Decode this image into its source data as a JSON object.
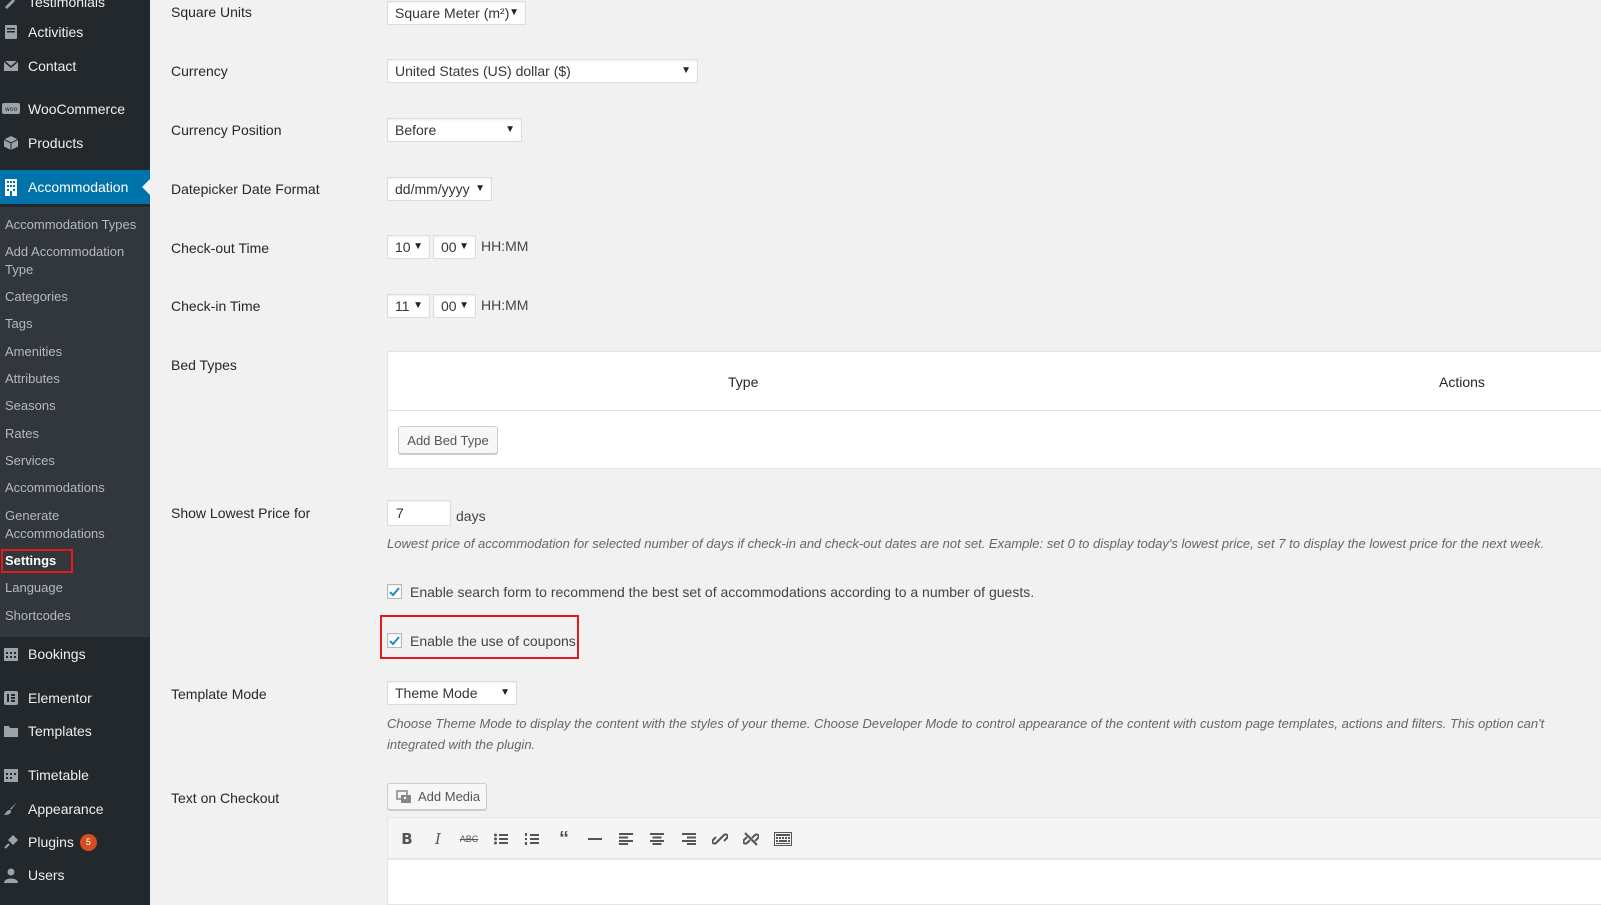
{
  "sidebar": {
    "menu": [
      {
        "label": "Testimonials",
        "icon": "testimonials-icon"
      },
      {
        "label": "Activities",
        "icon": "activities-icon"
      },
      {
        "label": "Contact",
        "icon": "mail-icon"
      },
      {
        "label": "WooCommerce",
        "icon": "woocommerce-icon"
      },
      {
        "label": "Products",
        "icon": "box-icon"
      },
      {
        "label": "Accommodation",
        "icon": "building-icon"
      },
      {
        "label": "Bookings",
        "icon": "calendar-icon"
      },
      {
        "label": "Elementor",
        "icon": "elementor-icon"
      },
      {
        "label": "Templates",
        "icon": "folder-icon"
      },
      {
        "label": "Timetable",
        "icon": "calendar-icon"
      },
      {
        "label": "Appearance",
        "icon": "paintbrush-icon"
      },
      {
        "label": "Plugins",
        "icon": "plug-icon",
        "badge": "5"
      },
      {
        "label": "Users",
        "icon": "users-icon"
      }
    ],
    "submenu": [
      "Accommodation Types",
      "Add Accommodation Type",
      "Categories",
      "Tags",
      "Amenities",
      "Attributes",
      "Seasons",
      "Rates",
      "Services",
      "Accommodations",
      "Generate Accommodations",
      "Settings",
      "Language",
      "Shortcodes"
    ]
  },
  "form": {
    "square_units": {
      "label": "Square Units",
      "value": "Square Meter (m²)"
    },
    "currency": {
      "label": "Currency",
      "value": "United States (US) dollar ($)"
    },
    "currency_position": {
      "label": "Currency Position",
      "value": "Before"
    },
    "date_format": {
      "label": "Datepicker Date Format",
      "value": "dd/mm/yyyy"
    },
    "checkout_time": {
      "label": "Check-out Time",
      "hour": "10",
      "minute": "00",
      "hint": "HH:MM"
    },
    "checkin_time": {
      "label": "Check-in Time",
      "hour": "11",
      "minute": "00",
      "hint": "HH:MM"
    },
    "bed_types": {
      "label": "Bed Types",
      "col_type": "Type",
      "col_actions": "Actions",
      "add_button": "Add Bed Type"
    },
    "lowest_price": {
      "label": "Show Lowest Price for",
      "value": "7",
      "unit": "days",
      "description": "Lowest price of accommodation for selected number of days if check-in and check-out dates are not set. Example: set 0 to display today's lowest price, set 7 to display the lowest price for the next week."
    },
    "search_form_checkbox": {
      "label": "Enable search form to recommend the best set of accommodations according to a number of guests.",
      "checked": true
    },
    "coupons_checkbox": {
      "label": "Enable the use of coupons.",
      "checked": true
    },
    "template_mode": {
      "label": "Template Mode",
      "value": "Theme Mode",
      "description_line1": "Choose Theme Mode to display the content with the styles of your theme. Choose Developer Mode to control appearance of the content with custom page templates, actions and filters. This option can't",
      "description_line2": "integrated with the plugin."
    },
    "text_on_checkout": {
      "label": "Text on Checkout",
      "add_media": "Add Media"
    }
  },
  "editor_toolbar": [
    "bold",
    "italic",
    "strikethrough",
    "bullet-list",
    "numbered-list",
    "blockquote",
    "horizontal-rule",
    "align-left",
    "align-center",
    "align-right",
    "link",
    "unlink",
    "toolbar-toggle"
  ],
  "colors": {
    "sidebar": "#23282d",
    "submenu": "#32373c",
    "accent": "#0073aa",
    "highlight": "#e3191c",
    "badge": "#d54e21"
  }
}
